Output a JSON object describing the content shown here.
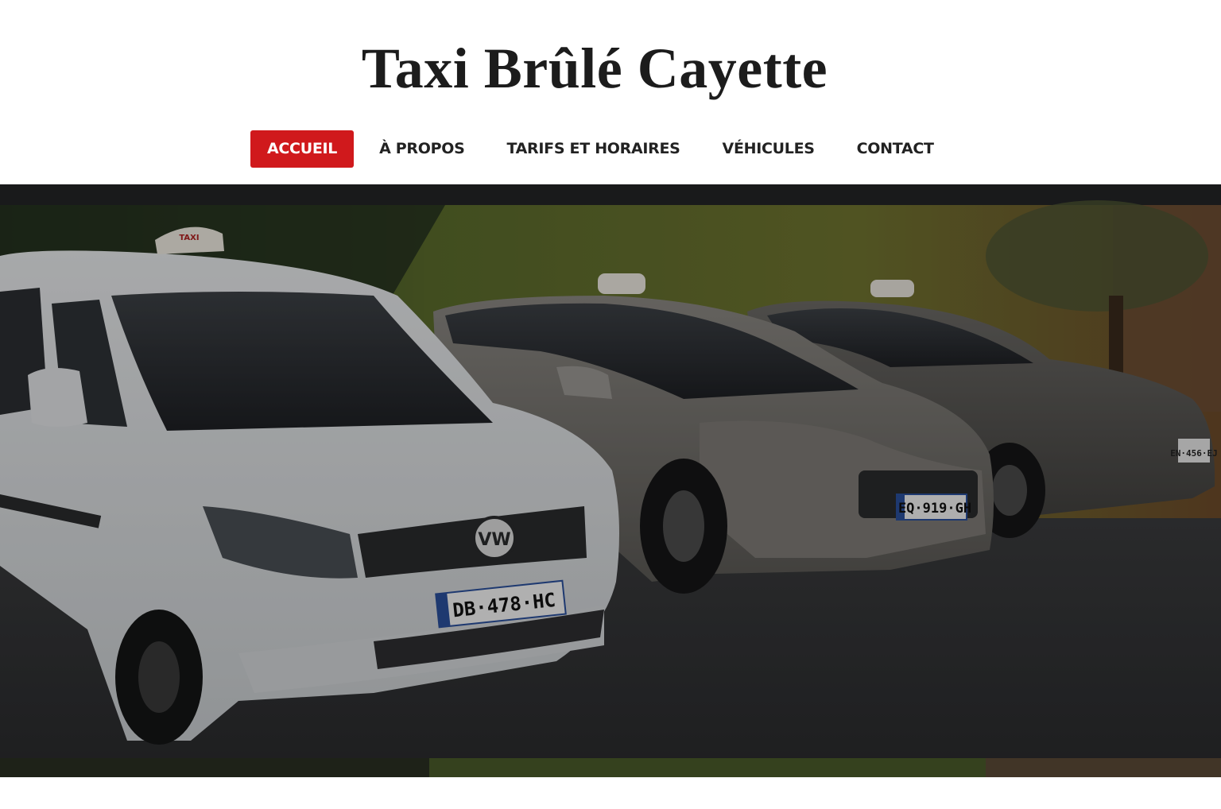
{
  "site": {
    "title": "Taxi Brûlé Cayette"
  },
  "nav": {
    "items": [
      {
        "label": "ACCUEIL",
        "active": true
      },
      {
        "label": "À PROPOS",
        "active": false
      },
      {
        "label": "TARIFS ET HORAIRES",
        "active": false
      },
      {
        "label": "VÉHICULES",
        "active": false
      },
      {
        "label": "CONTACT",
        "active": false
      }
    ]
  },
  "hero": {
    "plates": {
      "van": "DB·478·HC",
      "middle_car": "EQ·919·GH",
      "rear_car": "EN·456·EJ"
    },
    "taxi_sign": "TAXI"
  },
  "colors": {
    "accent": "#d0191c",
    "title": "#1c1c1c",
    "nav_text": "#222222",
    "background": "#ffffff"
  }
}
